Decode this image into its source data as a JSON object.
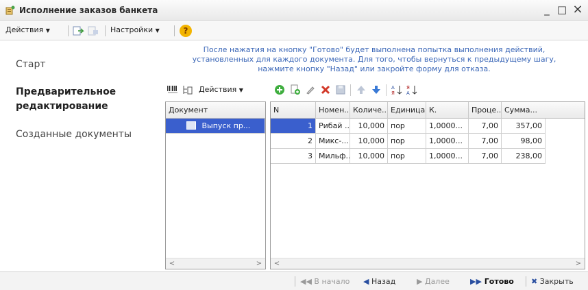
{
  "window": {
    "title": "Исполнение заказов банкета",
    "controls": {
      "minimize": "_",
      "maximize": "□",
      "close": "×"
    }
  },
  "toolbar": {
    "actions_label": "Действия",
    "settings_label": "Настройки",
    "help_label": "?"
  },
  "nav": {
    "items": [
      {
        "label": "Старт",
        "active": false
      },
      {
        "label": "Предварительное редактирование",
        "active": true
      },
      {
        "label": "Созданные документы",
        "active": false
      }
    ]
  },
  "hint": {
    "line1": "После нажатия на кнопку \"Готово\" будет выполнена попытка выполнения действий,",
    "line2": "установленных для каждого документа. Для того, чтобы вернуться к предыдущему шагу,",
    "line3": "нажмите кнопку \"Назад\" или закройте форму для отказа."
  },
  "panel_toolbar": {
    "actions_label": "Действия"
  },
  "documents_grid": {
    "header": "Документ",
    "rows": [
      {
        "label": "Выпуск пр..."
      }
    ]
  },
  "items_grid": {
    "columns": [
      "N",
      "Номен...",
      "Количе...",
      "Единица",
      "К.",
      "Проце...",
      "Сумма..."
    ],
    "rows": [
      {
        "n": "1",
        "nomenclature": "Рибай ...",
        "quantity": "10,000",
        "unit": "пор",
        "k": "1,0000...",
        "percent": "7,00",
        "sum": "357,00"
      },
      {
        "n": "2",
        "nomenclature": "Микс-...",
        "quantity": "10,000",
        "unit": "пор",
        "k": "1,0000...",
        "percent": "7,00",
        "sum": "98,00"
      },
      {
        "n": "3",
        "nomenclature": "Мильф...",
        "quantity": "10,000",
        "unit": "пор",
        "k": "1,0000...",
        "percent": "7,00",
        "sum": "238,00"
      }
    ]
  },
  "footer": {
    "to_start": "В начало",
    "back": "Назад",
    "next": "Далее",
    "finish": "Готово",
    "close": "Закрыть"
  },
  "colors": {
    "accent": "#3a5fcd",
    "hint_text": "#3a66b7"
  }
}
